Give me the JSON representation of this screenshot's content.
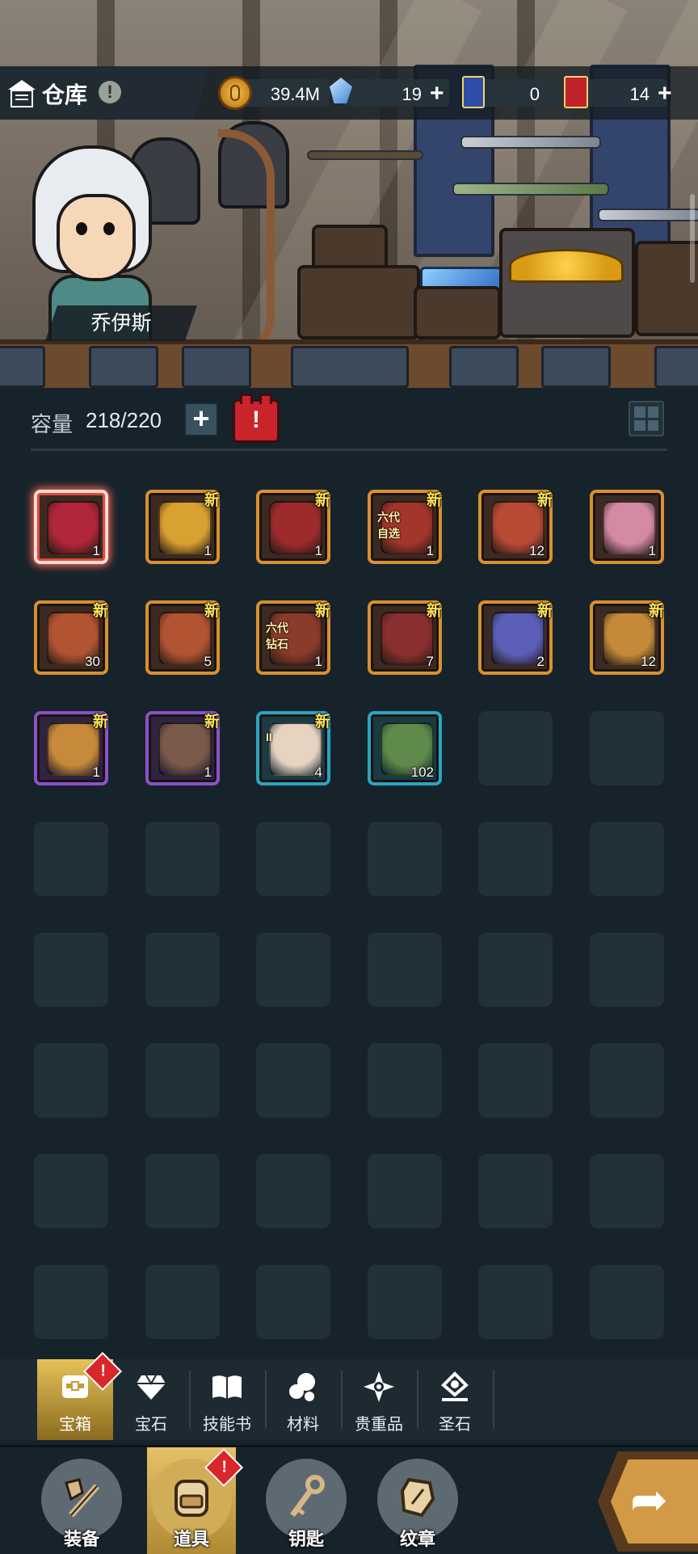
{
  "header": {
    "title": "仓库",
    "title_alert": "!"
  },
  "resources": {
    "gold": "39.4M",
    "crystal": "19",
    "blue_card": "0",
    "red_card": "14",
    "plus_symbol": "+"
  },
  "scene": {
    "hero_name": "乔伊斯"
  },
  "capacity": {
    "label": "容量",
    "value": "218/220",
    "plus_symbol": "+",
    "alert_symbol": "!"
  },
  "items": [
    {
      "count": "1",
      "new": "",
      "tag": "",
      "color": "#b0263a"
    },
    {
      "count": "1",
      "new": "新",
      "tag": "",
      "color": "#d9a032"
    },
    {
      "count": "1",
      "new": "新",
      "tag": "",
      "color": "#9e2b2b"
    },
    {
      "count": "1",
      "new": "新",
      "tag": "六代 自选",
      "color": "#a3352a"
    },
    {
      "count": "12",
      "new": "新",
      "tag": "",
      "color": "#b84a36"
    },
    {
      "count": "1",
      "new": "",
      "tag": "",
      "color": "#d48aa3"
    },
    {
      "count": "30",
      "new": "新",
      "tag": "",
      "color": "#b25432"
    },
    {
      "count": "5",
      "new": "新",
      "tag": "",
      "color": "#b25432"
    },
    {
      "count": "1",
      "new": "新",
      "tag": "六代 钻石",
      "color": "#8a3b2b"
    },
    {
      "count": "7",
      "new": "新",
      "tag": "",
      "color": "#8a2f2f"
    },
    {
      "count": "2",
      "new": "新",
      "tag": "",
      "color": "#5b5fb8"
    },
    {
      "count": "12",
      "new": "新",
      "tag": "",
      "color": "#c48a3a"
    },
    {
      "count": "1",
      "new": "新",
      "tag": "",
      "color": "#c78a3a"
    },
    {
      "count": "1",
      "new": "新",
      "tag": "",
      "color": "#7a5a4a"
    },
    {
      "count": "4",
      "new": "新",
      "tag": "II",
      "color": "#e7d3c2"
    },
    {
      "count": "102",
      "new": "",
      "tag": "",
      "color": "#5f8a4a"
    }
  ],
  "categories": [
    {
      "label": "宝箱",
      "icon": "chest-icon",
      "active": true,
      "badge": "!"
    },
    {
      "label": "宝石",
      "icon": "diamond-icon",
      "active": false,
      "badge": ""
    },
    {
      "label": "技能书",
      "icon": "book-icon",
      "active": false,
      "badge": ""
    },
    {
      "label": "材料",
      "icon": "materials-icon",
      "active": false,
      "badge": ""
    },
    {
      "label": "贵重品",
      "icon": "star-shield-icon",
      "active": false,
      "badge": ""
    },
    {
      "label": "圣石",
      "icon": "holy-stone-icon",
      "active": false,
      "badge": ""
    }
  ],
  "nav": [
    {
      "label": "装备",
      "icon": "sword-shield-icon",
      "active": false,
      "badge": ""
    },
    {
      "label": "道具",
      "icon": "backpack-icon",
      "active": true,
      "badge": "!"
    },
    {
      "label": "钥匙",
      "icon": "key-icon",
      "active": false,
      "badge": ""
    },
    {
      "label": "纹章",
      "icon": "emblem-icon",
      "active": false,
      "badge": ""
    }
  ],
  "colors": {
    "background": "#17232b",
    "accent_gold": "#e6c25a",
    "alert_red": "#d8262b",
    "new_tag": "#ffe45c"
  }
}
